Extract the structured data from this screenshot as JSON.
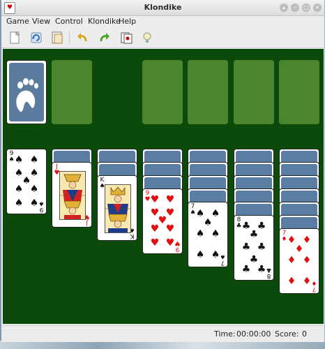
{
  "window": {
    "title": "Klondike"
  },
  "menu": [
    "Game",
    "View",
    "Control",
    "Klondike",
    "Help"
  ],
  "toolbar": {
    "buttons": [
      {
        "name": "new-game-icon"
      },
      {
        "name": "restart-icon"
      },
      {
        "name": "select-game-icon"
      },
      {
        "name": "undo-icon"
      },
      {
        "name": "redo-icon"
      },
      {
        "name": "deal-icon"
      },
      {
        "name": "hint-icon"
      }
    ]
  },
  "colors": {
    "felt": "#0c4a0c",
    "slot": "#4c8530",
    "card_back": "#5a7ea3",
    "red_suit": "#e01010"
  },
  "game": {
    "stock": {
      "face_down": true
    },
    "waste": {
      "empty": true
    },
    "foundations": {
      "count": 4,
      "empty": true
    },
    "tableau": [
      {
        "face_down": 0,
        "top": {
          "rank": "9",
          "suit": "♠",
          "color": "black"
        }
      },
      {
        "face_down": 1,
        "top": {
          "rank": "J",
          "suit": "♥",
          "color": "red"
        }
      },
      {
        "face_down": 2,
        "top": {
          "rank": "K",
          "suit": "♠",
          "color": "black"
        }
      },
      {
        "face_down": 3,
        "top": {
          "rank": "9",
          "suit": "♥",
          "color": "red"
        }
      },
      {
        "face_down": 4,
        "top": {
          "rank": "7",
          "suit": "♠",
          "color": "black"
        }
      },
      {
        "face_down": 5,
        "top": {
          "rank": "8",
          "suit": "♣",
          "color": "black"
        }
      },
      {
        "face_down": 6,
        "top": {
          "rank": "7",
          "suit": "♦",
          "color": "red"
        }
      }
    ]
  },
  "status": {
    "time_label": "Time:",
    "time": "00:00:00",
    "score_label": "Score:",
    "score": "0"
  }
}
